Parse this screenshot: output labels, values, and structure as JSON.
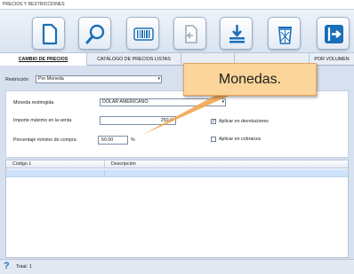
{
  "window": {
    "title": "PRECIOS Y RESTRICCIONES"
  },
  "toolbar": {
    "buttons": [
      {
        "icon": "new-document-icon"
      },
      {
        "icon": "search-icon"
      },
      {
        "icon": "barcode-icon"
      },
      {
        "icon": "import-icon"
      },
      {
        "icon": "download-icon"
      },
      {
        "icon": "trash-icon"
      },
      {
        "icon": "exit-icon"
      }
    ]
  },
  "tabs": [
    {
      "label": "CAMBIO DE PRECIOS"
    },
    {
      "label": "CATÁLOGO DE PRECIOS LISTAS"
    },
    {
      "label": ""
    },
    {
      "label": ""
    },
    {
      "label": "POR VOLUMEN"
    }
  ],
  "filter": {
    "label": "Restricción",
    "value": "Por Moneda"
  },
  "form": {
    "currency": {
      "label": "Moneda restringida",
      "value": "DOLAR AMERICANO"
    },
    "max_amount": {
      "label": "Importe máximo en la venta",
      "value": "250.0"
    },
    "min_percent": {
      "label": "Porcentaje mínimo de compra",
      "value": "50.00",
      "unit": "%"
    },
    "apply_returns": {
      "label": "Aplicar en devoluciones",
      "checked": true
    },
    "apply_collection": {
      "label": "Aplicar en cobranza",
      "checked": false
    }
  },
  "grid": {
    "columns": [
      "Código 1",
      "Descripción"
    ]
  },
  "status": {
    "help": "?",
    "total": "Total: 1"
  },
  "callout": {
    "text": "Monedas."
  },
  "colors": {
    "accent": "#1f6fc9",
    "callout_bg": "#fbd59a",
    "selected_row": "#cfe4fa"
  }
}
